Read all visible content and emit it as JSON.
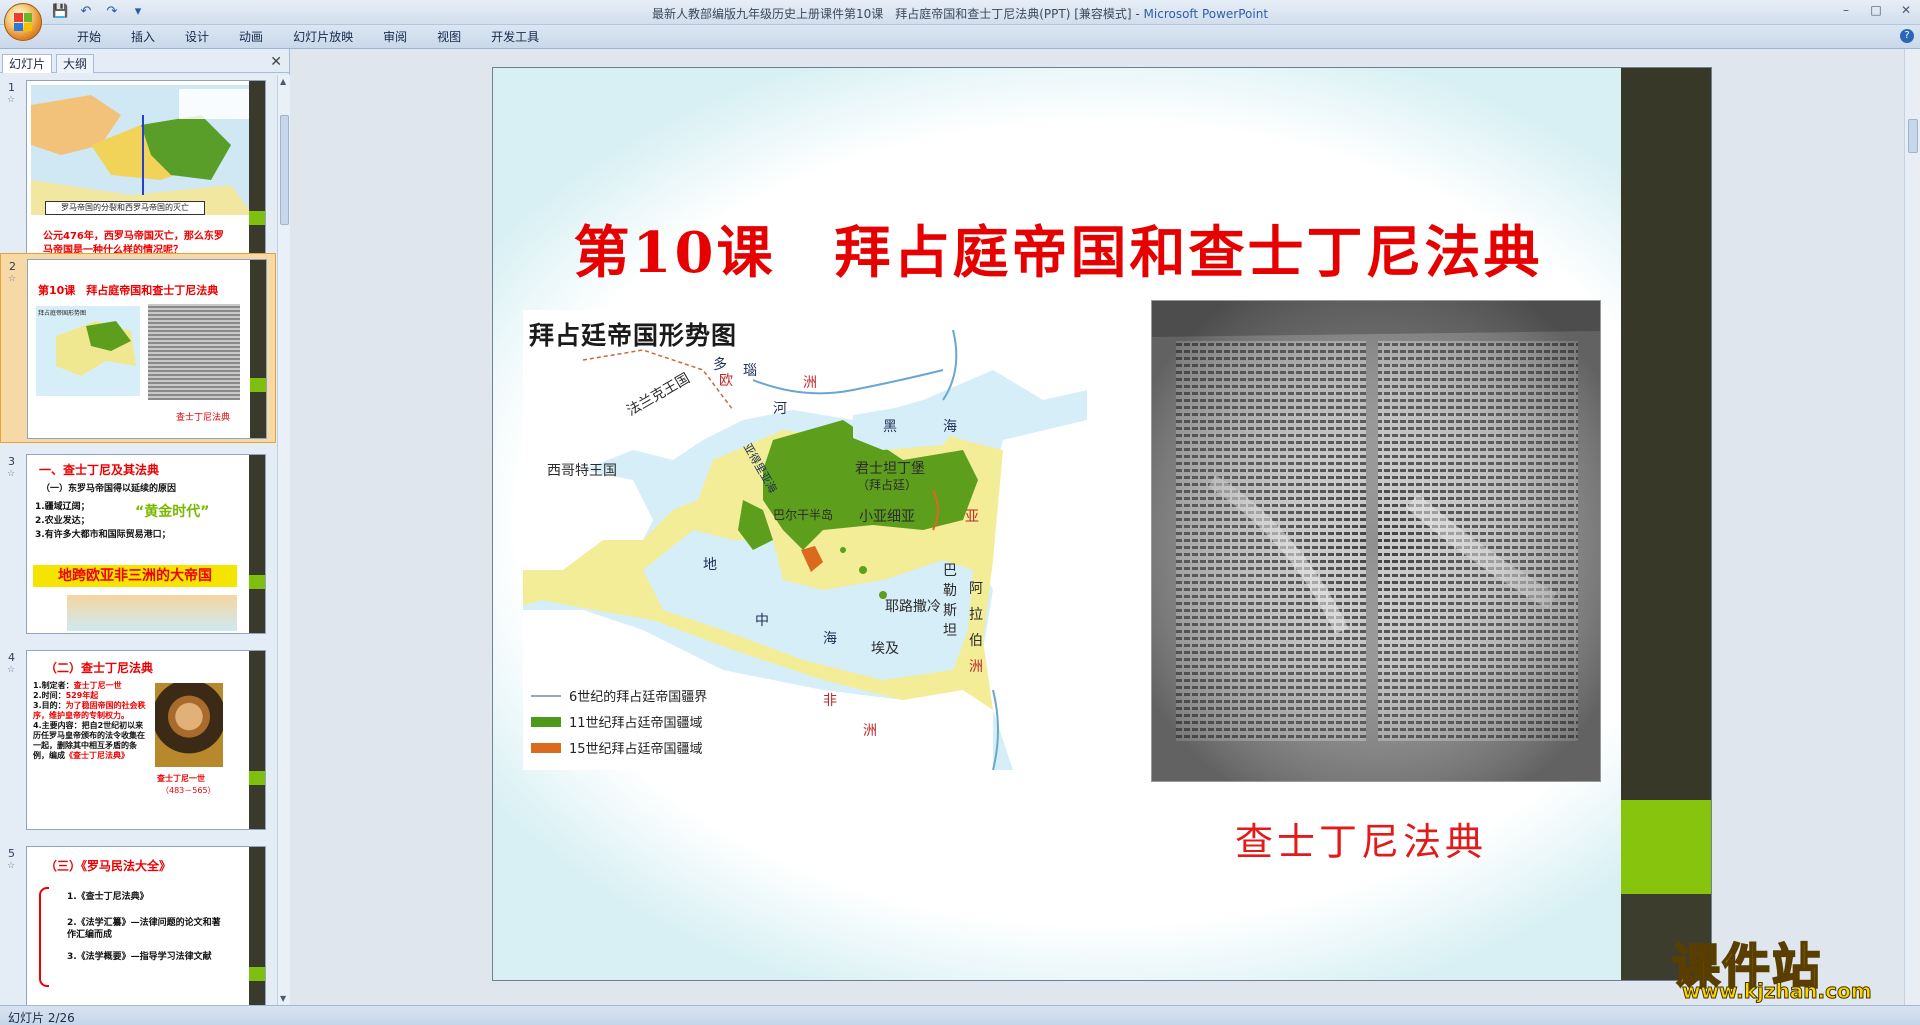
{
  "window": {
    "title_prefix": "最新人教部编版九年级历史上册课件第10课　拜占庭帝国和查士丁尼法典(PPT) [兼容模式] - ",
    "title_app": "Microsoft PowerPoint",
    "min_glyph": "–",
    "max_glyph": "□",
    "close_glyph": "✕"
  },
  "qat": {
    "save": "💾",
    "undo": "↶",
    "redo": "↷",
    "more": "▾"
  },
  "ribbon": {
    "tabs": [
      "开始",
      "插入",
      "设计",
      "动画",
      "幻灯片放映",
      "审阅",
      "视图",
      "开发工具"
    ],
    "help": "?"
  },
  "panel": {
    "tabs": [
      "幻灯片",
      "大纲"
    ],
    "close": "✕"
  },
  "thumbnails": [
    {
      "num": "1",
      "lines": [
        "公元476年，西罗马帝国灭亡，那么东罗",
        "马帝国是一种什么样的情况呢？"
      ],
      "map_caption": "罗马帝国的分裂和西罗马帝国的灭亡"
    },
    {
      "num": "2",
      "title": "第10课　拜占庭帝国和查士丁尼法典",
      "map_title": "拜占庭帝国形势图",
      "caption": "查士丁尼法典"
    },
    {
      "num": "3",
      "heading": "一、查士丁尼及其法典",
      "sub": "（一）东罗马帝国得以延续的原因",
      "items": [
        "1.疆域辽阔；",
        "2.农业发达；",
        "3.有许多大都市和国际贸易港口；"
      ],
      "golden": "“黄金时代”",
      "banner": "地跨欧亚非三洲的大帝国"
    },
    {
      "num": "4",
      "heading": "（二）查士丁尼法典",
      "items": [
        "1.制定者：",
        "查士丁尼一世",
        "2.时间：",
        "529年起",
        "3.目的：",
        "为了稳固帝国的社会秩序，维护皇帝的专制权力。",
        "4.主要内容：把自2世纪初以来历任罗马皇帝颁布的法令收集在一起，删除其中相互矛盾的条例，编成",
        "《查士丁尼法典》"
      ],
      "portrait_caption": "查士丁尼一世",
      "portrait_years": "（483－565）"
    },
    {
      "num": "5",
      "heading": "（三）《罗马民法大全》",
      "items": [
        "1.《查士丁尼法典》",
        "2.《法学汇纂》—法律问题的论文和著作汇编而成",
        "3.《法学概要》—指导学习法律文献"
      ]
    }
  ],
  "slide": {
    "title": "第10课　拜占庭帝国和查士丁尼法典",
    "map": {
      "heading": "拜占廷帝国形势图",
      "labels": {
        "frank": "法兰克王国",
        "europe_a": "欧",
        "europe_b": "洲",
        "visigoth": "西哥特王国",
        "constantinople": "君士坦丁堡",
        "byzantium": "（拜占廷）",
        "asia_minor": "小亚细亚",
        "black_a": "黑",
        "black_b": "海",
        "river_a": "多",
        "river_b": "瑙",
        "river_c": "河",
        "athens": "巴尔干半岛",
        "asia": "亚",
        "syria_1": "巴",
        "syria_2": "勒",
        "syria_3": "斯",
        "syria_4": "坦",
        "jerusalem": "耶路撒冷",
        "egypt": "埃及",
        "arabia_1": "阿",
        "arabia_2": "拉",
        "arabia_3": "伯",
        "arabia_4": "洲",
        "africa_a": "非",
        "africa_b": "洲",
        "med_1": "地",
        "med_2": "中",
        "med_3": "海",
        "adriatic": "亚得里亚海"
      },
      "legend": [
        {
          "label": "6世纪的拜占廷帝国疆界",
          "color": "#9aa7b3"
        },
        {
          "label": "11世纪拜占廷帝国疆域",
          "color": "#4d9a1a"
        },
        {
          "label": "15世纪拜占廷帝国疆域",
          "color": "#d96a1e"
        }
      ]
    },
    "caption": "查士丁尼法典"
  },
  "watermark": {
    "main": "课件站",
    "url": "www.kjzhan.com"
  },
  "status": {
    "text": "幻灯片 2/26"
  },
  "colors": {
    "slide_title": "#e60000",
    "accent_green": "#86c40d",
    "dark_bar": "#383829",
    "selection": "#f7d9a6"
  }
}
